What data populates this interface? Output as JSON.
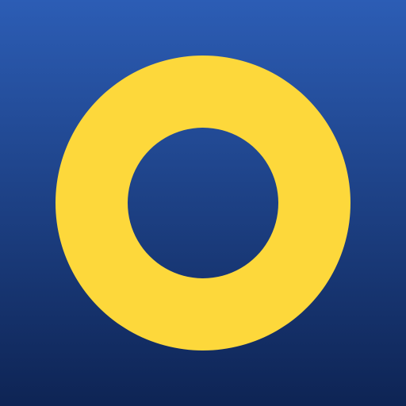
{
  "icon": {
    "name": "yellow-ring-icon",
    "colors": {
      "background_top": "#2C5DB5",
      "background_bottom": "#0E2454",
      "ring": "#FDD83B"
    }
  }
}
